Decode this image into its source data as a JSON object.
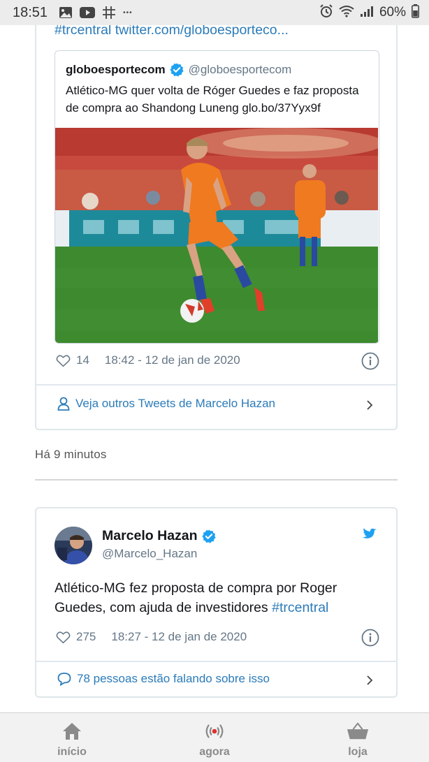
{
  "status_bar": {
    "time": "18:51",
    "more_dots": "•••",
    "battery": "60%"
  },
  "tweet1": {
    "link_line": "#trcentral twitter.com/globoesporteco...",
    "quote": {
      "name": "globoesportecom",
      "handle": "@globoesportecom",
      "text": "Atlético-MG quer volta de Róger Guedes e faz proposta de compra ao Shandong Luneng glo.bo/37Yyx9f"
    },
    "likes": "14",
    "timestamp": "18:42 - 12 de jan de 2020",
    "more_link": "Veja outros Tweets de Marcelo Hazan"
  },
  "feed": {
    "time_ago": "Há 9 minutos"
  },
  "tweet2": {
    "name": "Marcelo Hazan",
    "handle": "@Marcelo_Hazan",
    "text": "Atlético-MG fez proposta de compra por Roger Guedes, com ajuda de investidores ",
    "hashtag": "#trcentral",
    "likes": "275",
    "timestamp": "18:27 - 12 de jan de 2020",
    "more_link": "78 pessoas estão falando sobre isso"
  },
  "bottom_nav": {
    "items": [
      {
        "label": "início",
        "icon": "home-icon"
      },
      {
        "label": "agora",
        "icon": "live-broadcast-icon"
      },
      {
        "label": "loja",
        "icon": "shopping-basket-icon"
      }
    ]
  },
  "colors": {
    "link": "#2b7bb9",
    "verified": "#1da1f2",
    "muted": "#657786",
    "pitch": "#3e8a2e",
    "jersey": "#f07a1f"
  }
}
